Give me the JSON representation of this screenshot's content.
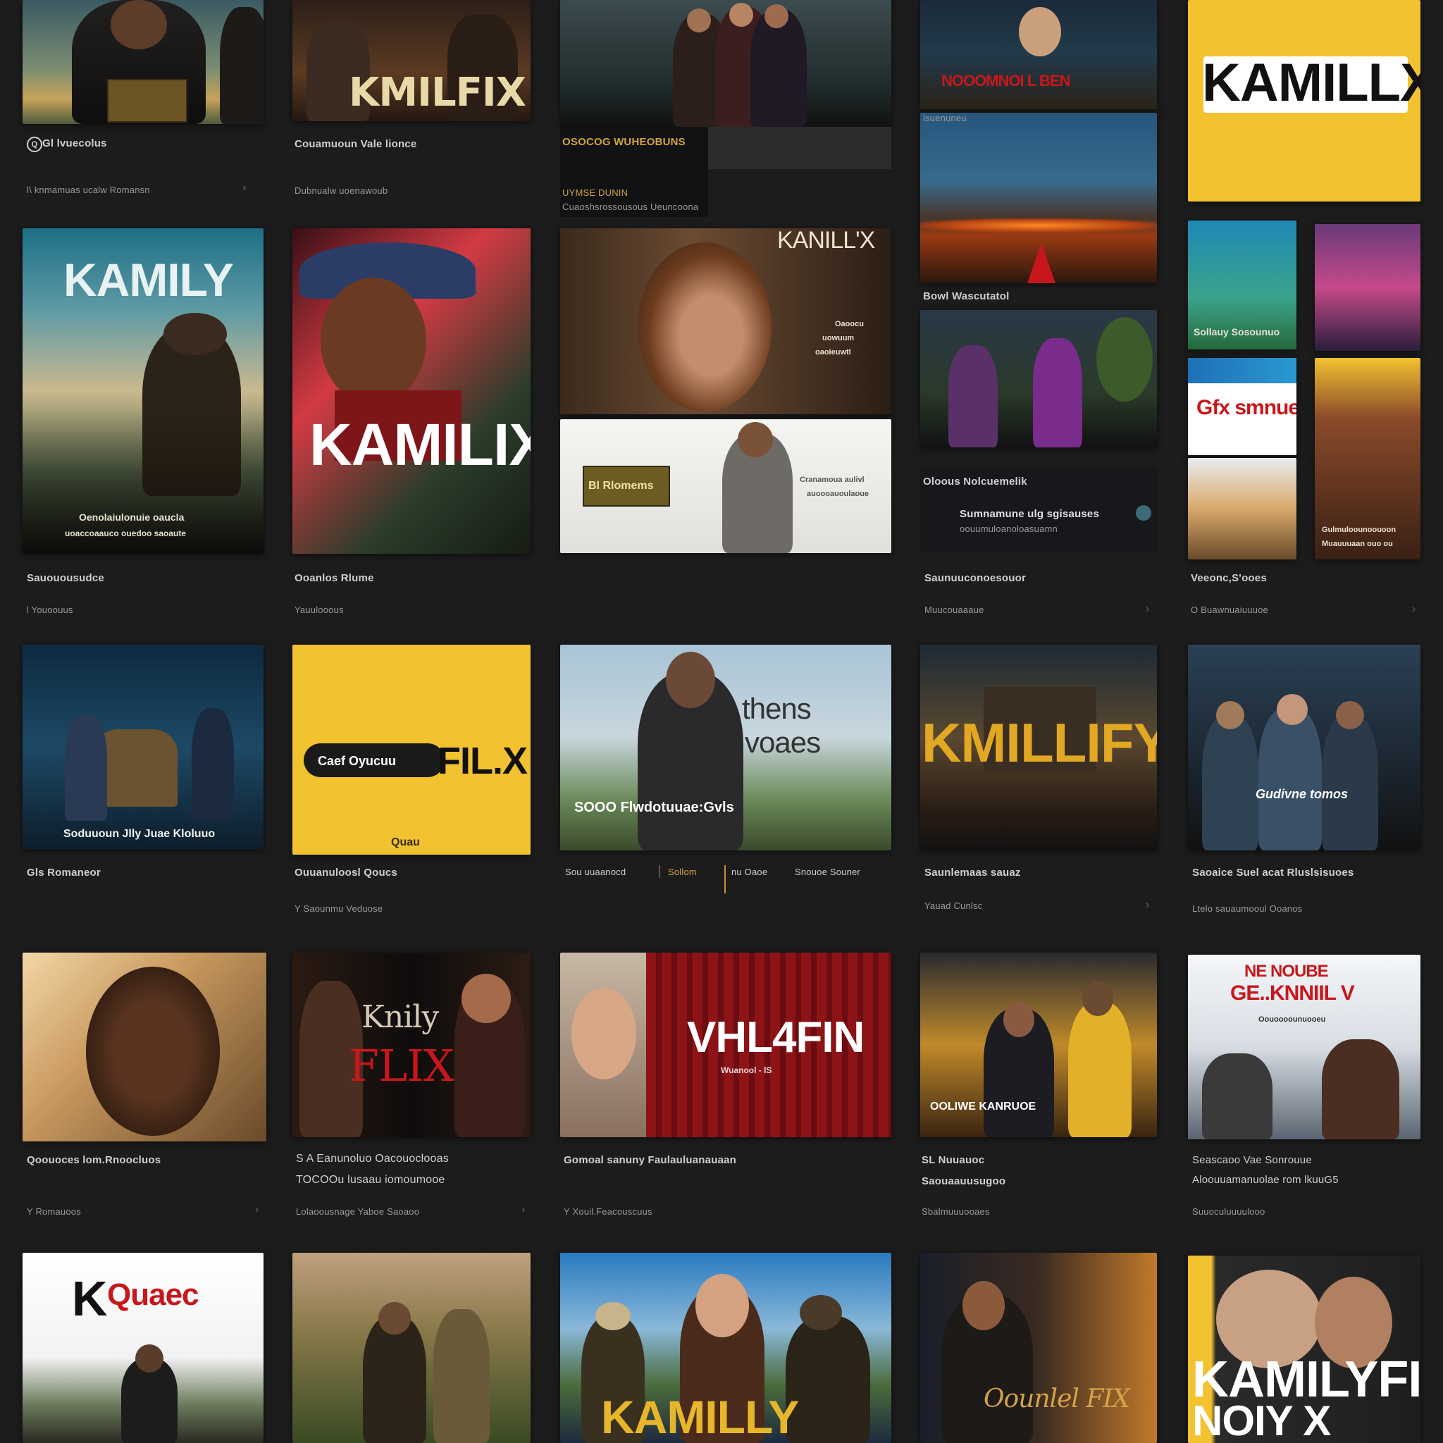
{
  "row1": {
    "c1": {
      "caption": "Gl lvuecolus",
      "meta": "l\\ knmamuas ucalw  Romansn",
      "badge": "Q"
    },
    "c2": {
      "poster_title": "KMILFIX",
      "caption": "Couamuoun Vale lionce",
      "meta": "Dubnualw  uoenawoub"
    },
    "c3": {
      "poster_title": "",
      "caption": "OSOCOG WUHEOBUNS",
      "meta": "UYMSE DUNIN",
      "meta2": "Cuaoshsrossousous Ueuncoona"
    },
    "c4": {
      "banner": "NOOOMNOI  L BEN",
      "caption": "Bowl Wascutatol",
      "meta": "lsuenuneu"
    },
    "c5": {
      "poster_title": "KAMILLX"
    }
  },
  "row2": {
    "c1": {
      "poster_title": "KAMILY",
      "poster_sub": "Oenolaiulonuie oaucla",
      "poster_sub2": "uoaccoaauco ouedoo saoaute",
      "caption": "Sauouousudce",
      "meta": "l Youoouus"
    },
    "c2": {
      "poster_title": "KAMILIX",
      "caption": "Ooanlos Rlume",
      "meta": "Yauulooous"
    },
    "c3": {
      "poster_title": "KANILL'X",
      "side_text": "Oaoocu",
      "side_text2": "uowuum",
      "side_text3": "oaoieuwtl",
      "card_label": "Bl Rlomems",
      "card_text": "Cranamoua aulivl",
      "card_text2": "auoooauoulaoue"
    },
    "c4": {
      "caption": "Oloous Nolcuemelik",
      "caption2": "Sumnamune ulg sgisauses",
      "meta": "oouumuloanoloasuamn",
      "caption3": "Saunuuconoesouor",
      "meta2": "Muucouaaaue"
    },
    "c5": {
      "tile1": "Sollauy Sosounuo",
      "tile2": "Gfx smnuei",
      "tile3": "Gulmuloounoouoon",
      "tile3b": "Muauuuaan ouo ou",
      "caption": "Veeonc,S'ooes",
      "meta": "O Buawnuaiuuuoe"
    }
  },
  "row3": {
    "c1": {
      "poster_sub": "Soduuoun Jlly Juae  Kloluuo",
      "caption": "Gls Romaneor",
      "meta": ""
    },
    "c2": {
      "pill": "Caef Oyucuu",
      "poster_title": "FIL.X",
      "caption": "Ouuanuloosl Qoucs",
      "meta": "Y Saounmu Veduose",
      "stamp": "Quau"
    },
    "c3": {
      "title1": "thens",
      "title2": "voaes",
      "line": "SOOO  Flwdotuuae:Gvls",
      "tab1": "Sou uuaanocd",
      "tab2": "Sollom",
      "tab3": "nu Oaoe",
      "tab4": "Snouoe Souner"
    },
    "c4": {
      "poster_title": "KMILLIFY",
      "caption": "Saunlemaas sauaz",
      "meta": "Yauad Cunlsc"
    },
    "c5": {
      "poster_sub": "Gudivne tomos",
      "caption": "Saoaice Suel acat Rluslsisuoes",
      "meta": "Ltelo sauaumooul Ooanos"
    }
  },
  "row4": {
    "c1": {
      "caption": "Qoouoces lom.Rnoocluos",
      "meta": "Y Romauoos"
    },
    "c2": {
      "poster_title": "Knily",
      "poster_title2": "FLIX",
      "caption": "S A Eanunoluo Oacouoclooas",
      "caption2": "TOCOOu lusaau iomoumooe",
      "meta": "Lolaoousnage  Yaboe Saoaoo"
    },
    "c3": {
      "poster_title": "VHL4FIN",
      "sub": "Wuanool  -  lS",
      "caption": "Gomoal sanuny  Faulauluanauaan",
      "meta": "Y Xouil.Feacouscuus"
    },
    "c4": {
      "line": "OOLIWE KANRUOE",
      "caption": "SL Nuuauoc",
      "caption2": "Saouaauusugoo",
      "meta": "Sbalmuuuooaes"
    },
    "c5": {
      "poster_title": "NE NOUBE",
      "poster_title2": "GE..KNNIIL V",
      "poster_sub": "Oouoooounuooeu",
      "caption": "Seascaoo  Vae Sonrouue",
      "caption2": "Aloouuamanuolae  rom lkuuG5",
      "meta": "Suuoculuuuulooo"
    }
  },
  "row5": {
    "c1": {
      "poster_title": "K",
      "poster_title2": "Quaec"
    },
    "c2": {},
    "c3": {
      "poster_title": "KAMILLY"
    },
    "c4": {
      "poster_title": "Oounlel  FIX"
    },
    "c5": {
      "poster_title": "KAMILYFIX",
      "poster_title2": "NOIY  X"
    }
  },
  "colors": {
    "background": "#1c1c1d",
    "brand_yellow": "#f2c230",
    "brand_red": "#c8171c",
    "caption": "#cfcfcf"
  }
}
